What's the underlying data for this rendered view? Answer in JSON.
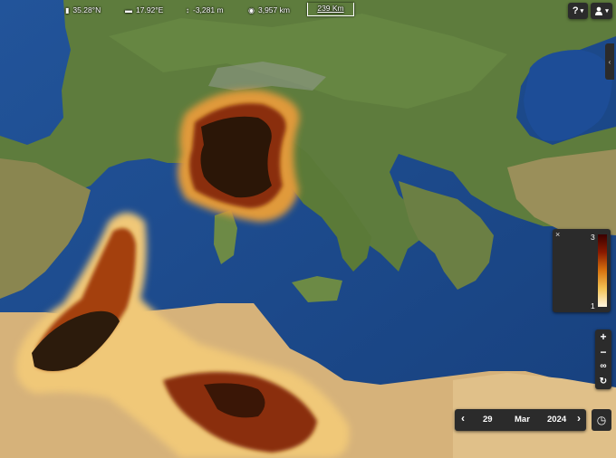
{
  "readout": {
    "latitude": "35.28°N",
    "longitude": "17.92°E",
    "elevation": "-3,281 m",
    "distance": "3,957 km",
    "scale_label": "239 Km"
  },
  "toolbar": {
    "help_label": "?",
    "user_label": "user",
    "dropdown_glyph": "▾"
  },
  "legend": {
    "max_label": "3",
    "min_label": "1",
    "close_glyph": "×",
    "gradient_colors": [
      "#3a0000",
      "#8b1a00",
      "#d8730f",
      "#f2c355",
      "#fff6e0"
    ]
  },
  "zoom": {
    "zoom_in": "+",
    "zoom_out": "−",
    "link_glyph": "∞",
    "reset_glyph": "↻"
  },
  "date": {
    "prev_glyph": "‹",
    "day": "29",
    "month": "Mar",
    "year": "2024",
    "next_glyph": "›",
    "clock_glyph": "◷"
  },
  "colors": {
    "sea": "#1e4f8f",
    "land": "#5b7a3a",
    "desert": "#d8b47c",
    "dust_dark": "#3a0d00",
    "dust_mid": "#a4410a",
    "dust_light": "#f0c878",
    "panel": "#2b2b2b"
  }
}
